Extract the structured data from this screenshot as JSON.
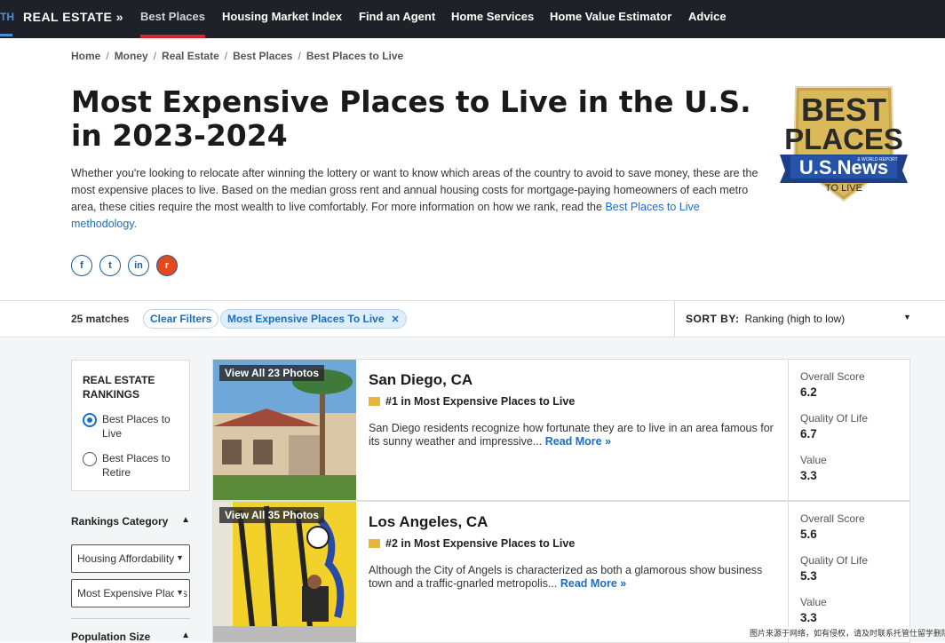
{
  "topnav": {
    "partial_left": "TH",
    "brand": "REAL ESTATE »",
    "items": [
      "Best Places",
      "Housing Market Index",
      "Find an Agent",
      "Home Services",
      "Home Value Estimator",
      "Advice"
    ]
  },
  "breadcrumb": [
    "Home",
    "Money",
    "Real Estate",
    "Best Places",
    "Best Places to Live"
  ],
  "page_title": "Most Expensive Places to Live in the U.S. in 2023-2024",
  "intro": {
    "text": "Whether you're looking to relocate after winning the lottery or want to know which areas of the country to avoid to save money, these are the most expensive places to live. Based on the median gross rent and annual housing costs for mortgage-paying homeowners of each metro area, these cities require the most wealth to live comfortably. For more information on how we rank, read the ",
    "link": "Best Places to Live methodology."
  },
  "badge": {
    "line1": "BEST",
    "line2": "PLACES",
    "brand": "U.S.News",
    "small": "& WORLD REPORT",
    "sub": "TO LIVE"
  },
  "social": [
    {
      "icon": "facebook-icon",
      "glyph": "f"
    },
    {
      "icon": "twitter-icon",
      "glyph": "t"
    },
    {
      "icon": "linkedin-icon",
      "glyph": "in"
    },
    {
      "icon": "reddit-icon",
      "glyph": "r"
    }
  ],
  "filters": {
    "matches": "25 matches",
    "clear": "Clear Filters",
    "active": "Most Expensive Places To Live",
    "sort_label": "SORT BY:",
    "sort_value": "Ranking (high to low)"
  },
  "sidebar": {
    "rankings_header": "REAL ESTATE RANKINGS",
    "options": [
      {
        "label": "Best Places to Live",
        "selected": true
      },
      {
        "label": "Best Places to Retire",
        "selected": false
      }
    ],
    "category_header": "Rankings Category",
    "select1": "Housing Affordability",
    "select2": "Most Expensive Places to Live",
    "population_header": "Population Size"
  },
  "results": [
    {
      "photos": "View All 23 Photos",
      "title": "San Diego, CA",
      "rank": "#1 in Most Expensive Places to Live",
      "desc": "San Diego residents recognize how fortunate they are to live in an area famous for its sunny weather and impressive...",
      "read_more": "Read More »",
      "scores": [
        {
          "label": "Overall Score",
          "value": "6.2"
        },
        {
          "label": "Quality Of Life",
          "value": "6.7"
        },
        {
          "label": "Value",
          "value": "3.3"
        }
      ]
    },
    {
      "photos": "View All 35 Photos",
      "title": "Los Angeles, CA",
      "rank": "#2 in Most Expensive Places to Live",
      "desc": "Although the City of Angels is characterized as both a glamorous show business town and a traffic-gnarled metropolis...",
      "read_more": "Read More »",
      "scores": [
        {
          "label": "Overall Score",
          "value": "5.6"
        },
        {
          "label": "Quality Of Life",
          "value": "5.3"
        },
        {
          "label": "Value",
          "value": "3.3"
        }
      ]
    }
  ],
  "watermark": "图片来源于网络，如有侵权，请及时联系托管仕留学删除"
}
